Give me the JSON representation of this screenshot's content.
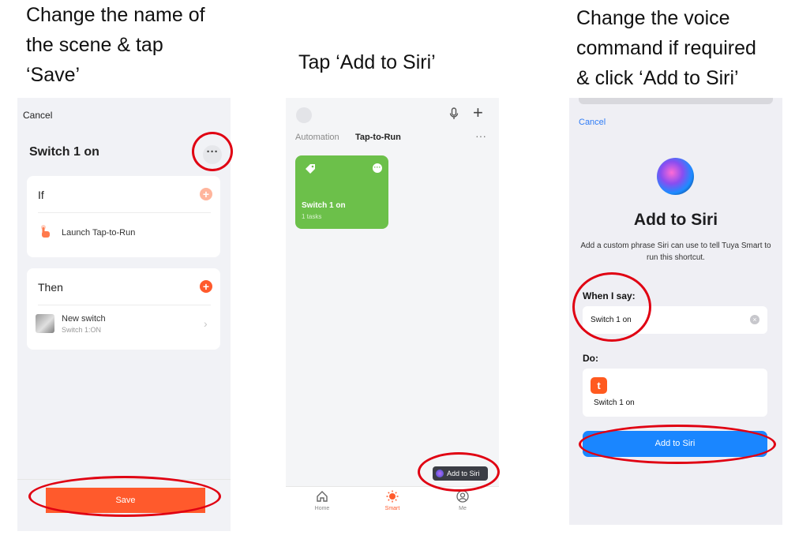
{
  "captions": {
    "step1": [
      "Change the name of",
      "the scene & tap",
      "‘Save’"
    ],
    "step2": "Tap ‘Add to Siri’",
    "step3": [
      "Change the voice",
      "command if required",
      "& click ‘Add to Siri’"
    ]
  },
  "screen1": {
    "cancel": "Cancel",
    "scene_name": "Switch 1 on",
    "more_icon": "···",
    "if_card": {
      "header": "If",
      "row_label": "Launch Tap-to-Run"
    },
    "then_card": {
      "header": "Then",
      "row_title": "New switch",
      "row_subtitle": "Switch 1:ON",
      "chevron": "›"
    },
    "save_label": "Save",
    "colors": {
      "accent": "#ff5a2c",
      "accent_light": "#ffb59c"
    }
  },
  "screen2": {
    "tabs": [
      "Automation",
      "Tap-to-Run"
    ],
    "active_tab": "Tap-to-Run",
    "more_icon": "···",
    "scene_card": {
      "name": "Switch 1 on",
      "tasks": "1 tasks",
      "color": "#6cc04a"
    },
    "siri_button": "Add to Siri",
    "nav": [
      {
        "label": "Home",
        "icon": "home-icon"
      },
      {
        "label": "Smart",
        "icon": "smart-sun-icon",
        "active": true
      },
      {
        "label": "Me",
        "icon": "profile-icon"
      }
    ]
  },
  "screen3": {
    "cancel": "Cancel",
    "heading": "Add to Siri",
    "description": "Add a custom phrase Siri can use to tell Tuya Smart to run this shortcut.",
    "when_label": "When I say:",
    "phrase_value": "Switch 1 on",
    "do_label": "Do:",
    "app_icon_letter": "t",
    "do_shortcut": "Switch 1 on",
    "add_button": "Add to Siri",
    "colors": {
      "link": "#2f7cf6",
      "button": "#1a86ff"
    }
  },
  "highlight_color": "#e00012"
}
